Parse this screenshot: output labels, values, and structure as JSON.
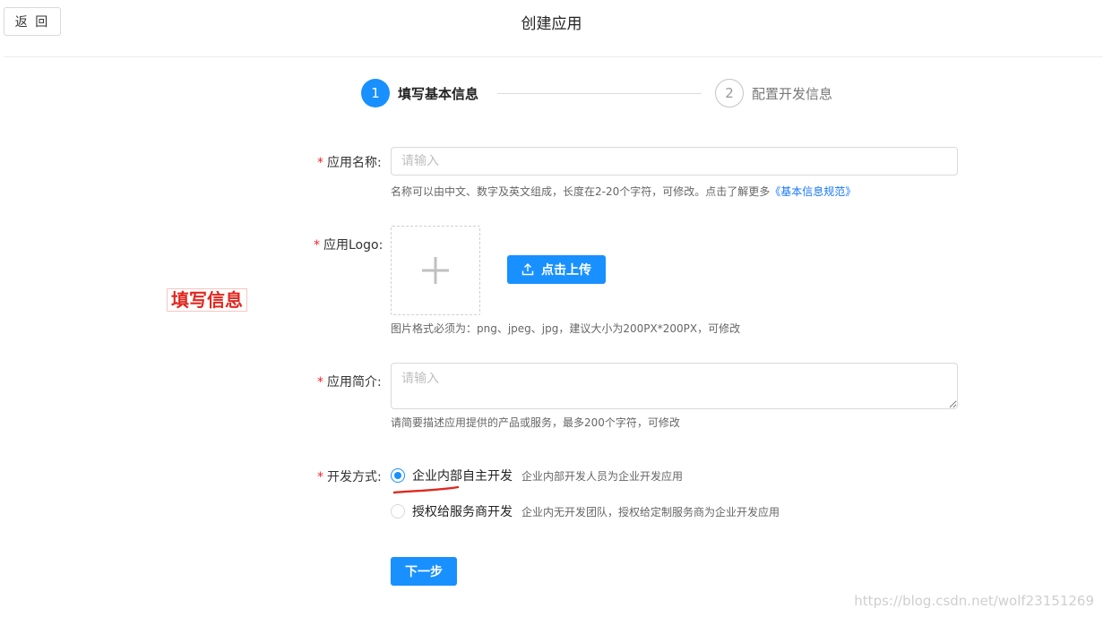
{
  "header": {
    "back_label": "返 回",
    "title": "创建应用"
  },
  "steps": [
    {
      "number": "1",
      "title": "填写基本信息",
      "state": "active"
    },
    {
      "number": "2",
      "title": "配置开发信息",
      "state": "inactive"
    }
  ],
  "annotation": {
    "text": "填写信息"
  },
  "form": {
    "required_mark": "*",
    "name": {
      "label": "应用名称:",
      "placeholder": "请输入",
      "value": "",
      "help": "名称可以由中文、数字及英文组成，长度在2-20个字符，可修改。点击了解更多",
      "help_link": "《基本信息规范》"
    },
    "logo": {
      "label": "应用Logo:",
      "upload_label": "点击上传",
      "help": "图片格式必须为：png、jpeg、jpg，建议大小为200PX*200PX，可修改"
    },
    "intro": {
      "label": "应用简介:",
      "placeholder": "请输入",
      "value": "",
      "help": "请简要描述应用提供的产品或服务，最多200个字符，可修改"
    },
    "dev_mode": {
      "label": "开发方式:",
      "options": [
        {
          "label": "企业内部自主开发",
          "desc": "企业内部开发人员为企业开发应用",
          "checked": true
        },
        {
          "label": "授权给服务商开发",
          "desc": "企业内无开发团队，授权给定制服务商为企业开发应用",
          "checked": false
        }
      ]
    },
    "next_label": "下一步"
  },
  "watermark": "https://blog.csdn.net/wolf23151269",
  "colors": {
    "primary": "#1890ff",
    "required": "#f5222d",
    "annotation": "#e0281f"
  }
}
